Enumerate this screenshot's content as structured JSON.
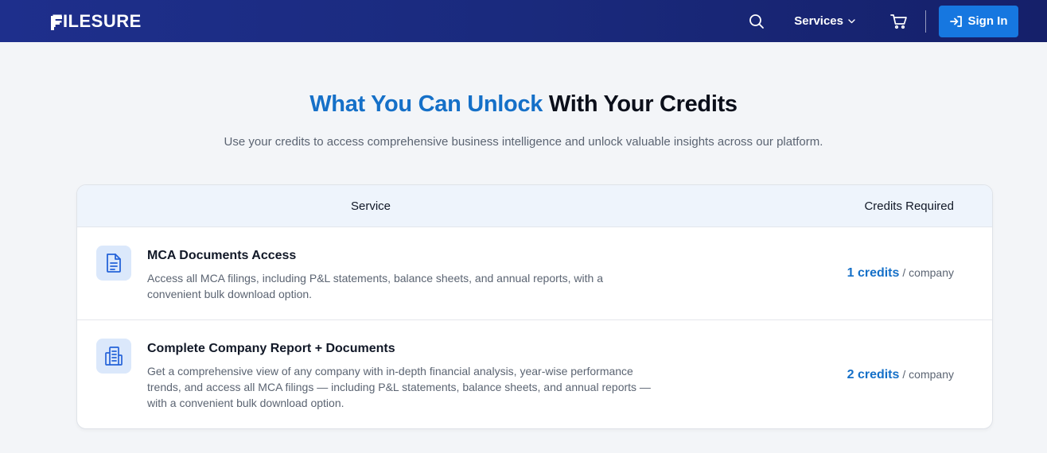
{
  "brand": {
    "name": "FILESURE"
  },
  "nav": {
    "services_label": "Services",
    "signin_label": "Sign In",
    "icons": [
      "search-icon",
      "chevron-down-icon",
      "cart-icon",
      "sign-in-icon"
    ]
  },
  "hero": {
    "title_accent": "What You Can Unlock",
    "title_rest": "With Your Credits",
    "subtitle": "Use your credits to access comprehensive business intelligence and unlock valuable insights across our platform."
  },
  "table": {
    "headers": {
      "service": "Service",
      "credits": "Credits Required"
    },
    "rows": [
      {
        "icon": "document-icon",
        "title": "MCA Documents Access",
        "description": "Access all MCA filings, including P&L statements, balance sheets, and annual reports, with a convenient bulk download option.",
        "credits": "1 credits",
        "unit": "/ company"
      },
      {
        "icon": "building-report-icon",
        "title": "Complete Company Report + Documents",
        "description": "Get a comprehensive view of any company with in-depth financial analysis, year-wise performance trends, and access all MCA filings — including P&L statements, balance sheets, and annual reports — with a convenient bulk download option.",
        "credits": "2 credits",
        "unit": "/ company"
      }
    ]
  },
  "colors": {
    "nav_bg": "#1e2f8c",
    "accent": "#1570c8",
    "button": "#1677e0",
    "page_bg": "#f3f5f8"
  }
}
